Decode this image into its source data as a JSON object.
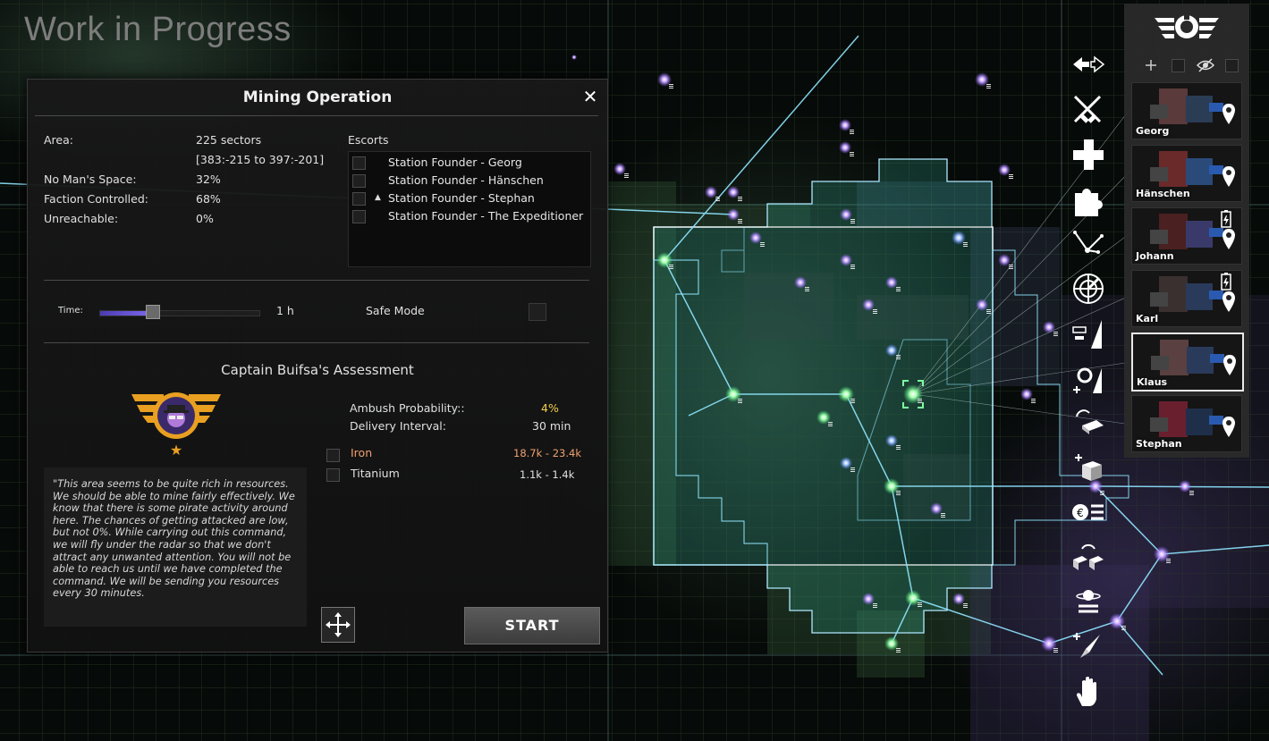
{
  "overlay_title": "Work in Progress",
  "mission": {
    "title": "Mining Operation",
    "close_icon": "close-icon",
    "stats": [
      {
        "label": "Area:",
        "value": "225 sectors"
      },
      {
        "label": "",
        "value": "[383:-215 to 397:-201]"
      },
      {
        "label": "No Man's Space:",
        "value": "32%"
      },
      {
        "label": "Faction Controlled:",
        "value": "68%"
      },
      {
        "label": "Unreachable:",
        "value": "0%"
      }
    ],
    "escorts_label": "Escorts",
    "escorts": [
      {
        "name": "Station Founder - Georg",
        "checked": false,
        "marker": ""
      },
      {
        "name": "Station Founder - Hänschen",
        "checked": false,
        "marker": ""
      },
      {
        "name": "Station Founder - Stephan",
        "checked": false,
        "marker": "▲"
      },
      {
        "name": "Station Founder - The Expeditioner",
        "checked": false,
        "marker": ""
      }
    ],
    "time_label": "Time:",
    "time_value": "1 h",
    "time_slider_fraction": 0.33,
    "safe_mode_label": "Safe Mode",
    "assessment_title": "Captain Buifsa's Assessment",
    "captain_stars": 1,
    "ambush_label": "Ambush Probability::",
    "ambush_value": "4%",
    "interval_label": "Delivery Interval:",
    "interval_value": "30 min",
    "resources": [
      {
        "name": "Iron",
        "range": "18.7k - 23.4k",
        "color": "#f0a070"
      },
      {
        "name": "Titanium",
        "range": "1.1k - 1.4k",
        "color": "#ffffff"
      }
    ],
    "quote": "\"This area seems to be quite rich in resources. We should be able to mine fairly effectively. We know that there is some pirate activity around here. The chances of getting attacked are low, but not 0%. While carrying out this command, we will fly under the radar so that we don't attract any unwanted attention. You will not be able to reach us until we have completed the command. We will be sending you resources every 30 minutes.",
    "start_label": "START",
    "move_icon": "move-arrows-icon"
  },
  "toolbar": [
    "swap-arrows-icon",
    "crossed-swords-icon",
    "plus-icon",
    "puzzle-icon",
    "scatter-icon",
    "radar-icon",
    "sector-build-icon",
    "gear-build-icon",
    "refine-icon",
    "add-cargo-icon",
    "coin-list-icon",
    "trade-cargo-icon",
    "planet-icon",
    "add-rocket-icon",
    "hand-icon"
  ],
  "shipbar": {
    "faction_icon": "faction-emblem-icon",
    "filter_icons": [
      "tree-filter-icon",
      "eye-slash-icon"
    ],
    "ships": [
      {
        "name": "Georg",
        "selected": false,
        "battery": false
      },
      {
        "name": "Hänschen",
        "selected": false,
        "battery": false
      },
      {
        "name": "Johann",
        "selected": false,
        "battery": true
      },
      {
        "name": "Karl",
        "selected": false,
        "battery": true
      },
      {
        "name": "Klaus",
        "selected": true,
        "battery": false
      },
      {
        "name": "Stephan",
        "selected": false,
        "battery": false
      }
    ]
  },
  "colors": {
    "accent_purple": "#7e6af0",
    "ambush_yellow": "#f2d04a",
    "route_cyan": "#8fe6ff",
    "area_green": "#2f7d6a"
  }
}
